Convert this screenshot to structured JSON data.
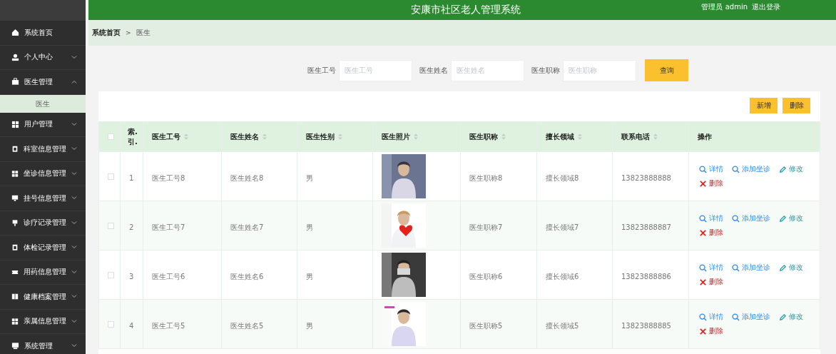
{
  "header": {
    "title": "安康市社区老人管理系统",
    "user_label": "管理员 admin",
    "logout": "退出登录"
  },
  "sidebar": {
    "items": [
      {
        "label": "系统首页",
        "kind": "link"
      },
      {
        "label": "个人中心",
        "kind": "menu",
        "expanded": false
      },
      {
        "label": "医生管理",
        "kind": "menu",
        "expanded": true,
        "children": [
          {
            "label": "医生",
            "selected": true
          }
        ]
      },
      {
        "label": "用户管理",
        "kind": "menu",
        "expanded": false
      },
      {
        "label": "科室信息管理",
        "kind": "menu",
        "expanded": false
      },
      {
        "label": "坐诊信息管理",
        "kind": "menu",
        "expanded": false
      },
      {
        "label": "挂号信息管理",
        "kind": "menu",
        "expanded": false
      },
      {
        "label": "诊疗记录管理",
        "kind": "menu",
        "expanded": false
      },
      {
        "label": "体检记录管理",
        "kind": "menu",
        "expanded": false
      },
      {
        "label": "用药信息管理",
        "kind": "menu",
        "expanded": false
      },
      {
        "label": "健康档案管理",
        "kind": "menu",
        "expanded": false
      },
      {
        "label": "亲属信息管理",
        "kind": "menu",
        "expanded": false
      },
      {
        "label": "系统管理",
        "kind": "menu",
        "expanded": false
      }
    ]
  },
  "breadcrumb": {
    "items": [
      "系统首页",
      "医生"
    ],
    "separator": ">"
  },
  "search": {
    "fields": [
      {
        "label": "医生工号",
        "placeholder": "医生工号"
      },
      {
        "label": "医生姓名",
        "placeholder": "医生姓名"
      },
      {
        "label": "医生职称",
        "placeholder": "医生职称"
      }
    ],
    "button": "查询"
  },
  "toolbar": {
    "buttons": [
      "新增",
      "删除"
    ]
  },
  "table": {
    "select_all": {
      "checked": false
    },
    "columns": [
      {
        "label": "索.引.",
        "sortable": false
      },
      {
        "label": "医生工号",
        "sortable": true
      },
      {
        "label": "医生姓名",
        "sortable": true
      },
      {
        "label": "医生性别",
        "sortable": true
      },
      {
        "label": "医生照片",
        "sortable": true
      },
      {
        "label": "医生职称",
        "sortable": true
      },
      {
        "label": "擅长领域",
        "sortable": true
      },
      {
        "label": "联系电话",
        "sortable": true
      },
      {
        "label": "操作",
        "sortable": false
      }
    ],
    "rows": [
      {
        "checked": false,
        "cells": [
          "1",
          "医生工号8",
          "医生姓名8",
          "男",
          {
            "kind": "picture"
          },
          "医生职称8",
          "擅长领域8",
          "13823888888"
        ],
        "actions": [
          {
            "kind": "view",
            "label": "详情"
          },
          {
            "kind": "add",
            "label": "添加坐诊"
          },
          {
            "kind": "edit",
            "label": "修改"
          },
          {
            "kind": "delete",
            "label": "删除"
          }
        ]
      },
      {
        "checked": false,
        "cells": [
          "2",
          "医生工号7",
          "医生姓名7",
          "男",
          {
            "kind": "picture"
          },
          "医生职称7",
          "擅长领域7",
          "13823888887"
        ],
        "actions": [
          {
            "kind": "view",
            "label": "详情"
          },
          {
            "kind": "add",
            "label": "添加坐诊"
          },
          {
            "kind": "edit",
            "label": "修改"
          },
          {
            "kind": "delete",
            "label": "删除"
          }
        ]
      },
      {
        "checked": false,
        "cells": [
          "3",
          "医生工号6",
          "医生姓名6",
          "男",
          {
            "kind": "picture"
          },
          "医生职称6",
          "擅长领域6",
          "13823888886"
        ],
        "actions": [
          {
            "kind": "view",
            "label": "详情"
          },
          {
            "kind": "add",
            "label": "添加坐诊"
          },
          {
            "kind": "edit",
            "label": "修改"
          },
          {
            "kind": "delete",
            "label": "删除"
          }
        ]
      },
      {
        "checked": false,
        "cells": [
          "4",
          "医生工号5",
          "医生姓名5",
          "男",
          {
            "kind": "picture"
          },
          "医生职称5",
          "擅长领域5",
          "13823888885"
        ],
        "actions": [
          {
            "kind": "view",
            "label": "详情"
          },
          {
            "kind": "add",
            "label": "添加坐诊"
          },
          {
            "kind": "edit",
            "label": "修改"
          },
          {
            "kind": "delete",
            "label": "删除"
          }
        ]
      }
    ]
  }
}
